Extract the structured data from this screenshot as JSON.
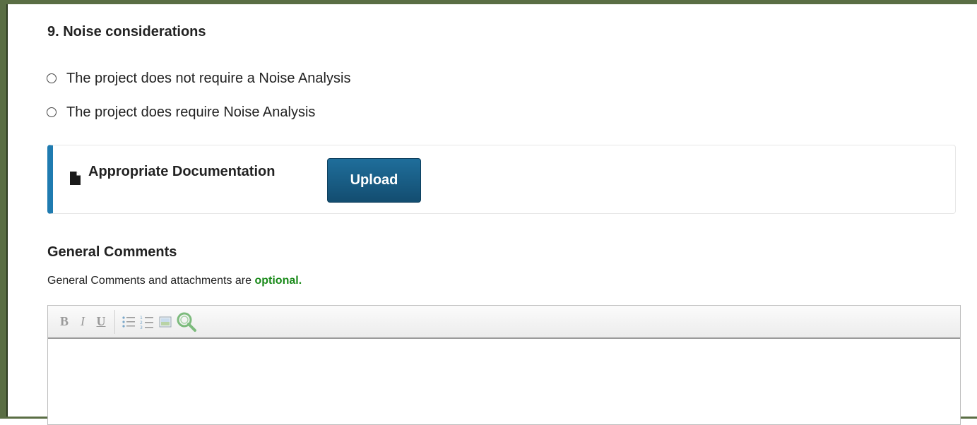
{
  "section": {
    "title": "9. Noise considerations",
    "options": [
      {
        "label": "The project does not require a Noise Analysis",
        "selected": false
      },
      {
        "label": "The project does require Noise Analysis",
        "selected": false
      }
    ]
  },
  "documentation": {
    "icon": "file-icon",
    "label": "Appropriate Documentation",
    "upload_label": "Upload",
    "accent_color": "#1f7bb0"
  },
  "general_comments": {
    "title": "General Comments",
    "note_prefix": "General Comments and attachments are",
    "note_emphasis": "optional.",
    "emphasis_color": "#1a8a1a"
  },
  "editor": {
    "toolbar": [
      {
        "name": "bold-button",
        "glyph": "B"
      },
      {
        "name": "italic-button",
        "glyph": "I"
      },
      {
        "name": "underline-button",
        "glyph": "U"
      },
      {
        "name": "bullet-list-icon",
        "glyph": ""
      },
      {
        "name": "numbered-list-icon",
        "glyph": ""
      },
      {
        "name": "image-icon",
        "glyph": ""
      },
      {
        "name": "magnifier-icon",
        "glyph": ""
      }
    ],
    "content": ""
  }
}
